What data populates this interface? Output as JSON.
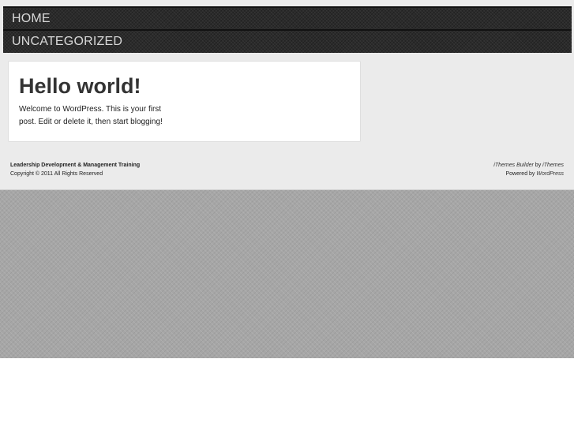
{
  "nav": {
    "items": [
      {
        "label": "HOME"
      },
      {
        "label": "UNCATEGORIZED"
      }
    ]
  },
  "post": {
    "title": "Hello world!",
    "body": "Welcome to WordPress. This is your first post. Edit or delete it, then start blogging!"
  },
  "footer": {
    "site_name": "Leadership Development & Management Training",
    "copyright": "Copyright © 2011 All Rights Reserved",
    "builder_link": "iThemes Builder",
    "by_text": " by ",
    "ithemes_link": "iThemes",
    "powered_text": "Powered by ",
    "wordpress_link": "WordPress"
  },
  "colors": {
    "nav_background": "#2b2b2b",
    "content_background": "#ebebeb",
    "page_background": "#a6a6a6",
    "post_background": "#ffffff"
  }
}
